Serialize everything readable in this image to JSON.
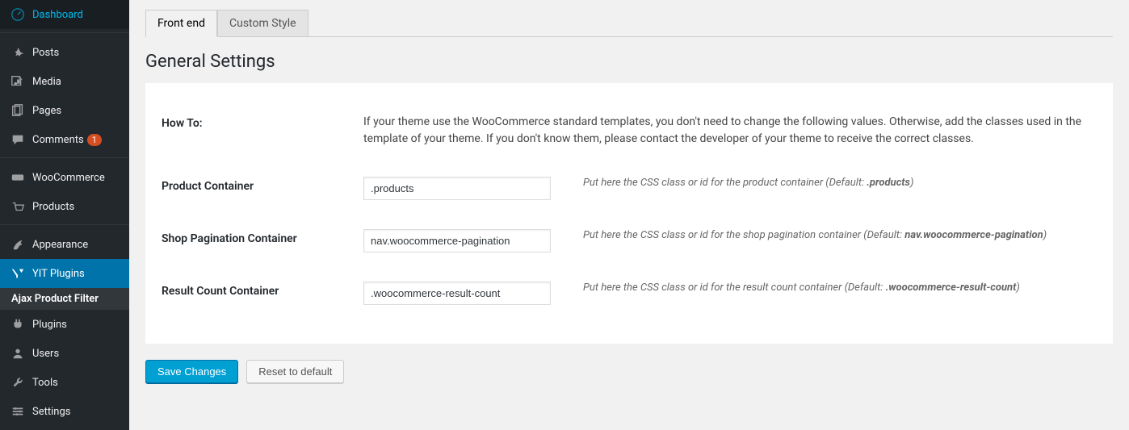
{
  "sidebar": {
    "items": [
      {
        "label": "Dashboard",
        "icon": "dashboard"
      },
      {
        "label": "Posts",
        "icon": "pin"
      },
      {
        "label": "Media",
        "icon": "media"
      },
      {
        "label": "Pages",
        "icon": "pages"
      },
      {
        "label": "Comments",
        "icon": "comments",
        "badge": "1"
      },
      {
        "label": "WooCommerce",
        "icon": "woo"
      },
      {
        "label": "Products",
        "icon": "products"
      },
      {
        "label": "Appearance",
        "icon": "appearance"
      },
      {
        "label": "YIT Plugins",
        "icon": "yit",
        "current": true
      },
      {
        "label": "Plugins",
        "icon": "plugins"
      },
      {
        "label": "Users",
        "icon": "users"
      },
      {
        "label": "Tools",
        "icon": "tools"
      },
      {
        "label": "Settings",
        "icon": "settings"
      }
    ],
    "submenu_label": "Ajax Product Filter"
  },
  "tabs": [
    {
      "label": "Front end",
      "active": true
    },
    {
      "label": "Custom Style",
      "active": false
    }
  ],
  "section_title": "General Settings",
  "howto": {
    "label": "How To:",
    "text": "If your theme use the WooCommerce standard templates, you don't need to change the following values. Otherwise, add the classes used in the template of your theme. If you don't know them, please contact the developer of your theme to receive the correct classes."
  },
  "fields": {
    "product_container": {
      "label": "Product Container",
      "value": ".products",
      "desc_prefix": "Put here the CSS class or id for the product container (Default: ",
      "desc_default": ".products",
      "desc_suffix": ")"
    },
    "shop_pagination": {
      "label": "Shop Pagination Container",
      "value": "nav.woocommerce-pagination",
      "desc_prefix": "Put here the CSS class or id for the shop pagination container (Default: ",
      "desc_default": "nav.woocommerce-pagination",
      "desc_suffix": ")"
    },
    "result_count": {
      "label": "Result Count Container",
      "value": ".woocommerce-result-count",
      "desc_prefix": "Put here the CSS class or id for the result count container (Default: ",
      "desc_default": ".woocommerce-result-count",
      "desc_suffix": ")"
    }
  },
  "buttons": {
    "save": "Save Changes",
    "reset": "Reset to default"
  }
}
